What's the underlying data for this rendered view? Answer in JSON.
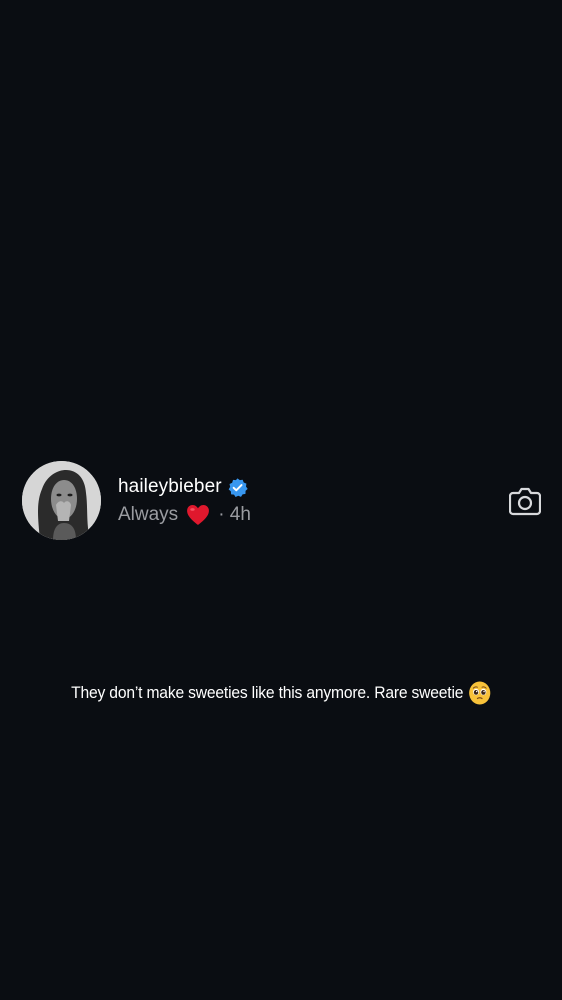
{
  "story": {
    "username": "haileybieber",
    "subtitle": "Always",
    "time": "· 4h",
    "caption": "They don’t make sweeties like this anymore. Rare sweetie",
    "avatar_icon": "profile-photo",
    "verified_icon": "verified-badge",
    "subtitle_emoji": "red-heart",
    "caption_emoji": "pleading-face",
    "action_icon": "camera"
  },
  "colors": {
    "background": "#0a0d12",
    "username": "#ffffff",
    "meta_text": "#9a9ca1",
    "verified": "#3897f0",
    "heart": "#e0182d",
    "emoji": "#f8c23a"
  }
}
